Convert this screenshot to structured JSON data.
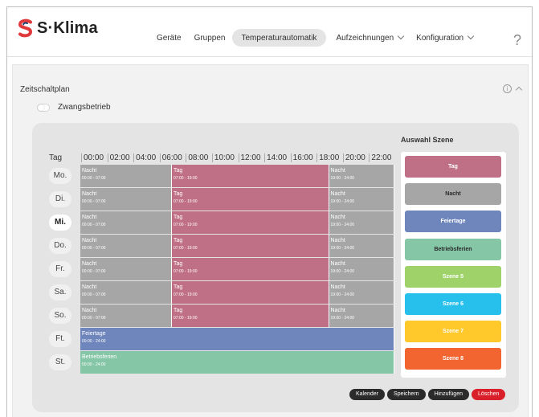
{
  "brand": {
    "name": "S·Klima"
  },
  "nav": {
    "items": [
      {
        "label": "Geräte"
      },
      {
        "label": "Gruppen"
      },
      {
        "label": "Temperaturautomatik",
        "active": true
      },
      {
        "label": "Aufzeichnungen",
        "dropdown": true
      },
      {
        "label": "Konfiguration",
        "dropdown": true
      }
    ],
    "help_icon": "?"
  },
  "section": {
    "title": "Zeitschaltplan",
    "info_icon": "i",
    "toggle_label": "Zwangsbetrieb",
    "toggle_on": false
  },
  "schedule": {
    "col_label": "Tag",
    "hours": [
      "00:00",
      "02:00",
      "04:00",
      "06:00",
      "08:00",
      "10:00",
      "12:00",
      "14:00",
      "16:00",
      "18:00",
      "20:00",
      "22:00"
    ],
    "days": [
      {
        "label": "Mo.",
        "segments": [
          {
            "name": "Nacht",
            "time": "00:00 - 07:00",
            "start": 0,
            "end": 7,
            "scene": "nacht"
          },
          {
            "name": "Tag",
            "time": "07:00 - 19:00",
            "start": 7,
            "end": 19,
            "scene": "tag"
          },
          {
            "name": "Nacht",
            "time": "19:00 - 24:00",
            "start": 19,
            "end": 24,
            "scene": "nacht"
          }
        ]
      },
      {
        "label": "Di.",
        "segments": [
          {
            "name": "Nacht",
            "time": "00:00 - 07:00",
            "start": 0,
            "end": 7,
            "scene": "nacht"
          },
          {
            "name": "Tag",
            "time": "07:00 - 19:00",
            "start": 7,
            "end": 19,
            "scene": "tag"
          },
          {
            "name": "Nacht",
            "time": "19:00 - 24:00",
            "start": 19,
            "end": 24,
            "scene": "nacht"
          }
        ]
      },
      {
        "label": "Mi.",
        "today": true,
        "segments": [
          {
            "name": "Nacht",
            "time": "00:00 - 07:00",
            "start": 0,
            "end": 7,
            "scene": "nacht"
          },
          {
            "name": "Tag",
            "time": "07:00 - 19:00",
            "start": 7,
            "end": 19,
            "scene": "tag"
          },
          {
            "name": "Nacht",
            "time": "19:00 - 24:00",
            "start": 19,
            "end": 24,
            "scene": "nacht"
          }
        ]
      },
      {
        "label": "Do.",
        "segments": [
          {
            "name": "Nacht",
            "time": "00:00 - 07:00",
            "start": 0,
            "end": 7,
            "scene": "nacht"
          },
          {
            "name": "Tag",
            "time": "07:00 - 19:00",
            "start": 7,
            "end": 19,
            "scene": "tag"
          },
          {
            "name": "Nacht",
            "time": "19:00 - 24:00",
            "start": 19,
            "end": 24,
            "scene": "nacht"
          }
        ]
      },
      {
        "label": "Fr.",
        "segments": [
          {
            "name": "Nacht",
            "time": "00:00 - 07:00",
            "start": 0,
            "end": 7,
            "scene": "nacht"
          },
          {
            "name": "Tag",
            "time": "07:00 - 19:00",
            "start": 7,
            "end": 19,
            "scene": "tag"
          },
          {
            "name": "Nacht",
            "time": "19:00 - 24:00",
            "start": 19,
            "end": 24,
            "scene": "nacht"
          }
        ]
      },
      {
        "label": "Sa.",
        "segments": [
          {
            "name": "Nacht",
            "time": "00:00 - 07:00",
            "start": 0,
            "end": 7,
            "scene": "nacht"
          },
          {
            "name": "Tag",
            "time": "07:00 - 19:00",
            "start": 7,
            "end": 19,
            "scene": "tag"
          },
          {
            "name": "Nacht",
            "time": "19:00 - 24:00",
            "start": 19,
            "end": 24,
            "scene": "nacht"
          }
        ]
      },
      {
        "label": "So.",
        "segments": [
          {
            "name": "Nacht",
            "time": "00:00 - 07:00",
            "start": 0,
            "end": 7,
            "scene": "nacht"
          },
          {
            "name": "Tag",
            "time": "07:00 - 19:00",
            "start": 7,
            "end": 19,
            "scene": "tag"
          },
          {
            "name": "Nacht",
            "time": "19:00 - 24:00",
            "start": 19,
            "end": 24,
            "scene": "nacht"
          }
        ]
      },
      {
        "label": "Ft.",
        "segments": [
          {
            "name": "Feiertage",
            "time": "00:00 - 24:00",
            "start": 0,
            "end": 24,
            "scene": "feiertage"
          }
        ]
      },
      {
        "label": "St.",
        "segments": [
          {
            "name": "Betriebsferien",
            "time": "00:00 - 24:00",
            "start": 0,
            "end": 24,
            "scene": "betriebsferien"
          }
        ]
      }
    ]
  },
  "scene_panel": {
    "title": "Auswahl Szene",
    "scenes": [
      {
        "id": "tag",
        "label": "Tag",
        "color": "#bf6f86"
      },
      {
        "id": "nacht",
        "label": "Nacht",
        "color": "#a6a6a6",
        "dark_text": true
      },
      {
        "id": "feiertage",
        "label": "Feiertage",
        "color": "#6f86bc"
      },
      {
        "id": "betriebsferien",
        "label": "Betriebsferien",
        "color": "#85c6a6",
        "dark_text": true
      },
      {
        "id": "szene5",
        "label": "Szene 5",
        "color": "#9fd36a"
      },
      {
        "id": "szene6",
        "label": "Szene 6",
        "color": "#27c0ec"
      },
      {
        "id": "szene7",
        "label": "Szene 7",
        "color": "#ffc82b"
      },
      {
        "id": "szene8",
        "label": "Szene 8",
        "color": "#f26530"
      }
    ]
  },
  "actions": {
    "kalender": "Kalender",
    "speichern": "Speichern",
    "hinzufuegen": "Hinzufügen",
    "loeschen": "Löschen"
  }
}
